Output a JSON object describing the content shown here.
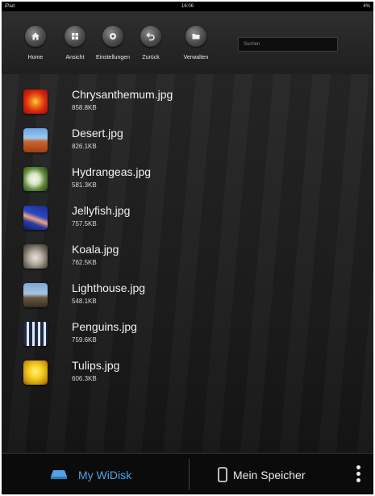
{
  "statusbar": {
    "carrier": "iPad",
    "time": "16:06",
    "battery": "4%"
  },
  "toolbar": {
    "buttons": [
      {
        "label": "Home",
        "icon": "home-icon"
      },
      {
        "label": "Ansicht",
        "icon": "grid-icon"
      },
      {
        "label": "Einstellungen",
        "icon": "gear-icon"
      },
      {
        "label": "Zurück",
        "icon": "back-icon"
      },
      {
        "label": "Verwalten",
        "icon": "folder-icon"
      }
    ],
    "search_placeholder": "Suchen"
  },
  "files": [
    {
      "name": "Chrysanthemum.jpg",
      "size": "858.8KB"
    },
    {
      "name": "Desert.jpg",
      "size": "826.1KB"
    },
    {
      "name": "Hydrangeas.jpg",
      "size": "581.3KB"
    },
    {
      "name": "Jellyfish.jpg",
      "size": "757.5KB"
    },
    {
      "name": "Koala.jpg",
      "size": "762.5KB"
    },
    {
      "name": "Lighthouse.jpg",
      "size": "548.1KB"
    },
    {
      "name": "Penguins.jpg",
      "size": "759.6KB"
    },
    {
      "name": "Tulips.jpg",
      "size": "606.3KB"
    }
  ],
  "bottombar": {
    "tabs": [
      {
        "label": "My WiDisk",
        "icon": "drive-icon",
        "active": true
      },
      {
        "label": "Mein Speicher",
        "icon": "phone-icon",
        "active": false
      }
    ],
    "more_icon": "more-vertical-icon"
  },
  "colors": {
    "accent": "#4fa3e6",
    "background": "#1a1a1a"
  }
}
